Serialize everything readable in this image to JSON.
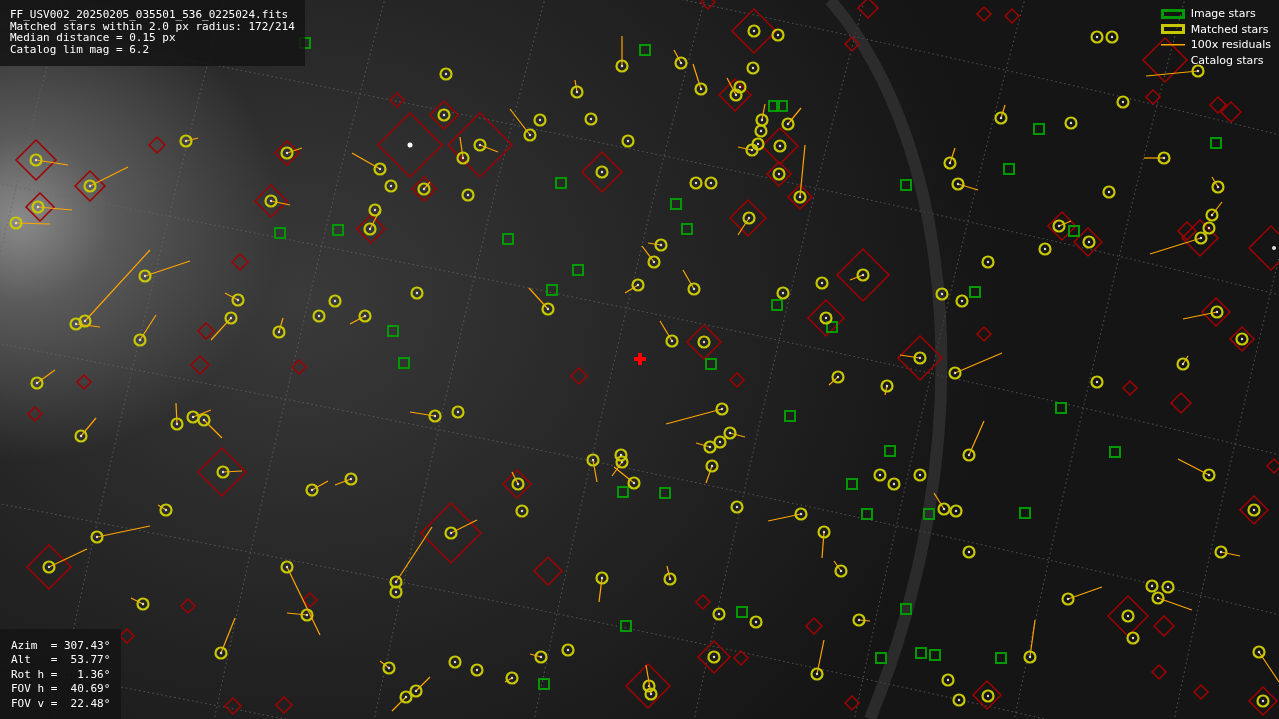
{
  "file_info": {
    "lines": [
      "FF_USV002_20250205_035501_536_0225024.fits",
      "Matched stars within 2.0 px radius: 172/214",
      "Median distance = 0.15 px",
      "Catalog lim mag = 6.2"
    ]
  },
  "legend": [
    {
      "kind": "image",
      "label": "Image stars"
    },
    {
      "kind": "matched",
      "label": "Matched stars"
    },
    {
      "kind": "residual",
      "label": "100x residuals"
    },
    {
      "kind": "catalog",
      "label": "Catalog stars"
    }
  ],
  "pointing": {
    "rows": [
      "Azim  = 307.43°",
      "Alt   =  53.77°",
      "Rot h =   1.36°",
      "FOV h =  40.69°",
      "FOV v =  22.48°"
    ]
  }
}
